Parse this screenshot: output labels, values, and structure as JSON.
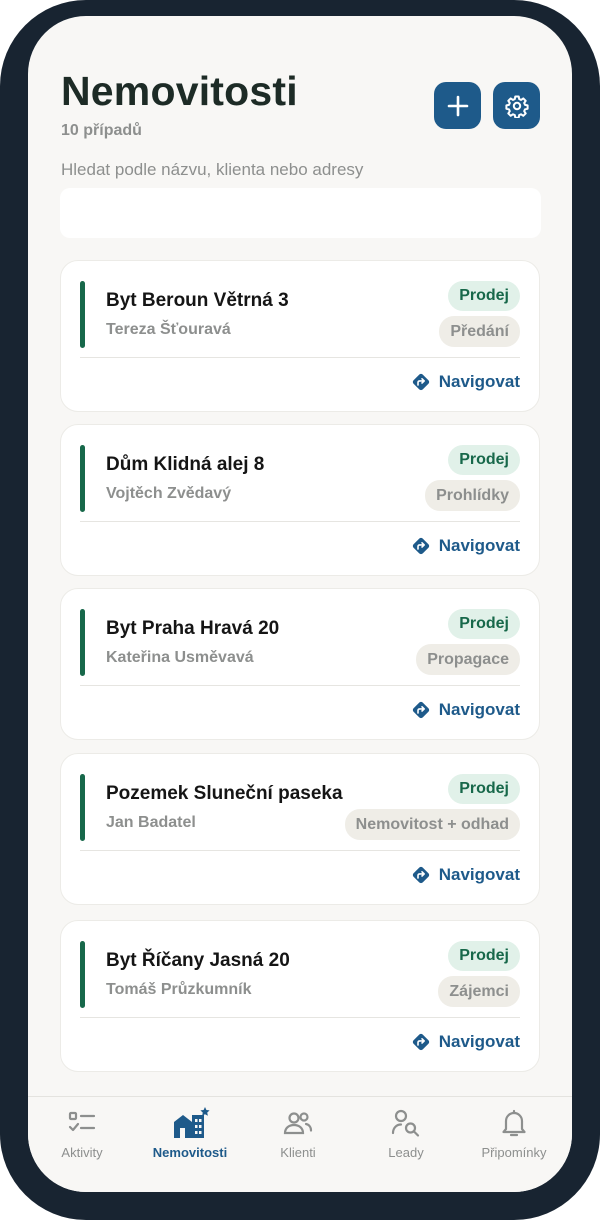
{
  "header": {
    "title": "Nemovitosti",
    "count": "10 případů",
    "add_icon": "plus-icon",
    "settings_icon": "gear-icon"
  },
  "search": {
    "label": "Hledat podle názvu, klienta nebo adresy",
    "value": "",
    "placeholder": ""
  },
  "properties": [
    {
      "title": "Byt Beroun Větrná 3",
      "client": "Tereza Šťouravá",
      "type": "Prodej",
      "stage": "Předání",
      "nav": "Navigovat"
    },
    {
      "title": "Dům Klidná alej 8",
      "client": "Vojtěch Zvědavý",
      "type": "Prodej",
      "stage": "Prohlídky",
      "nav": "Navigovat"
    },
    {
      "title": "Byt Praha Hravá 20",
      "client": "Kateřina Usměvavá",
      "type": "Prodej",
      "stage": "Propagace",
      "nav": "Navigovat"
    },
    {
      "title": "Pozemek Sluneční paseka",
      "client": "Jan Badatel",
      "type": "Prodej",
      "stage": "Nemovitost + odhad",
      "nav": "Navigovat"
    },
    {
      "title": "Byt Říčany Jasná 20",
      "client": "Tomáš Průzkumník",
      "type": "Prodej",
      "stage": "Zájemci",
      "nav": "Navigovat"
    }
  ],
  "tabs": [
    {
      "label": "Aktivity",
      "icon": "checklist-icon",
      "active": false
    },
    {
      "label": "Nemovitosti",
      "icon": "buildings-icon",
      "active": true
    },
    {
      "label": "Klienti",
      "icon": "users-icon",
      "active": false
    },
    {
      "label": "Leady",
      "icon": "user-search-icon",
      "active": false
    },
    {
      "label": "Připomínky",
      "icon": "bell-icon",
      "active": false
    }
  ],
  "colors": {
    "accent_green": "#17684a",
    "primary_blue": "#1e5a8a",
    "device_frame": "#182431",
    "screen_bg": "#f8f7f5",
    "badge_green_bg": "#e1f1e9",
    "badge_grey_bg": "#efede7"
  }
}
